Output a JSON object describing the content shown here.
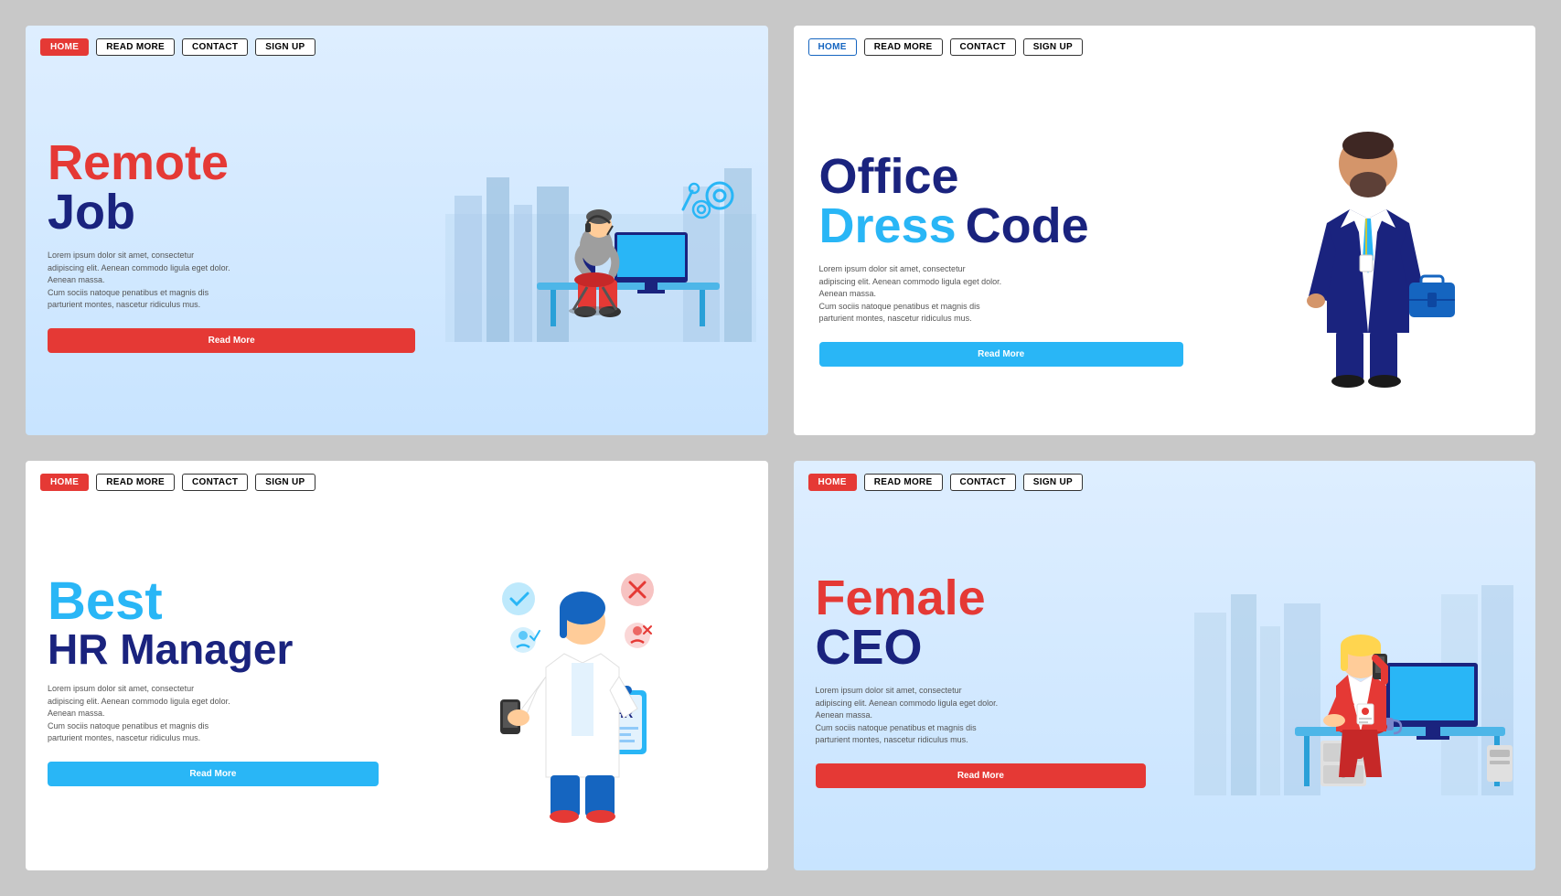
{
  "cards": [
    {
      "id": "card-1",
      "nav": {
        "home": "HOME",
        "readMore": "READ MORE",
        "contact": "CONTACT",
        "signUp": "SIGN UP"
      },
      "title_line1": "Remote",
      "title_line2": "Job",
      "lorem": "Lorem ipsum dolor sit amet, consectetur adipiscing elit. Aenean commodo ligula eget dolor. Aenean massa. Cum sociis natoque penatibus et magnis dis parturient montes, nascetur ridiculus mus.",
      "button": "Read More",
      "theme": "blue-bg"
    },
    {
      "id": "card-2",
      "nav": {
        "home": "HOME",
        "readMore": "READ MORE",
        "contact": "CONTACT",
        "signUp": "SIGN UP"
      },
      "title_line1": "Office",
      "title_line2": "Dress",
      "title_line3": "Code",
      "lorem": "Lorem ipsum dolor sit amet, consectetur adipiscing elit. Aenean commodo ligula eget dolor. Aenean massa. Cum sociis natoque penatibus et magnis dis parturient montes, nascetur ridiculus mus.",
      "button": "Read More",
      "theme": "white"
    },
    {
      "id": "card-3",
      "nav": {
        "home": "HOME",
        "readMore": "READ MORE",
        "contact": "CONTACT",
        "signUp": "SIGN UP"
      },
      "title_line1": "Best",
      "title_line2": "HR Manager",
      "lorem": "Lorem ipsum dolor sit amet, consectetur adipiscing elit. Aenean commodo ligula eget dolor. Aenean massa. Cum sociis natoque penatibus et magnis dis parturient montes, nascetur ridiculus mus.",
      "button": "Read More",
      "theme": "white"
    },
    {
      "id": "card-4",
      "nav": {
        "home": "HOME",
        "readMore": "READ MORE",
        "contact": "CONTACT",
        "signUp": "SIGN UP"
      },
      "title_line1": "Female",
      "title_line2": "CEO",
      "lorem": "Lorem ipsum dolor sit amet, consectetur adipiscing elit. Aenean commodo ligula eget dolor. Aenean massa. Cum sociis natoque penatibus et magnis dis parturient montes, nascetur ridiculus mus.",
      "button": "Read More",
      "theme": "blue-bg"
    }
  ]
}
